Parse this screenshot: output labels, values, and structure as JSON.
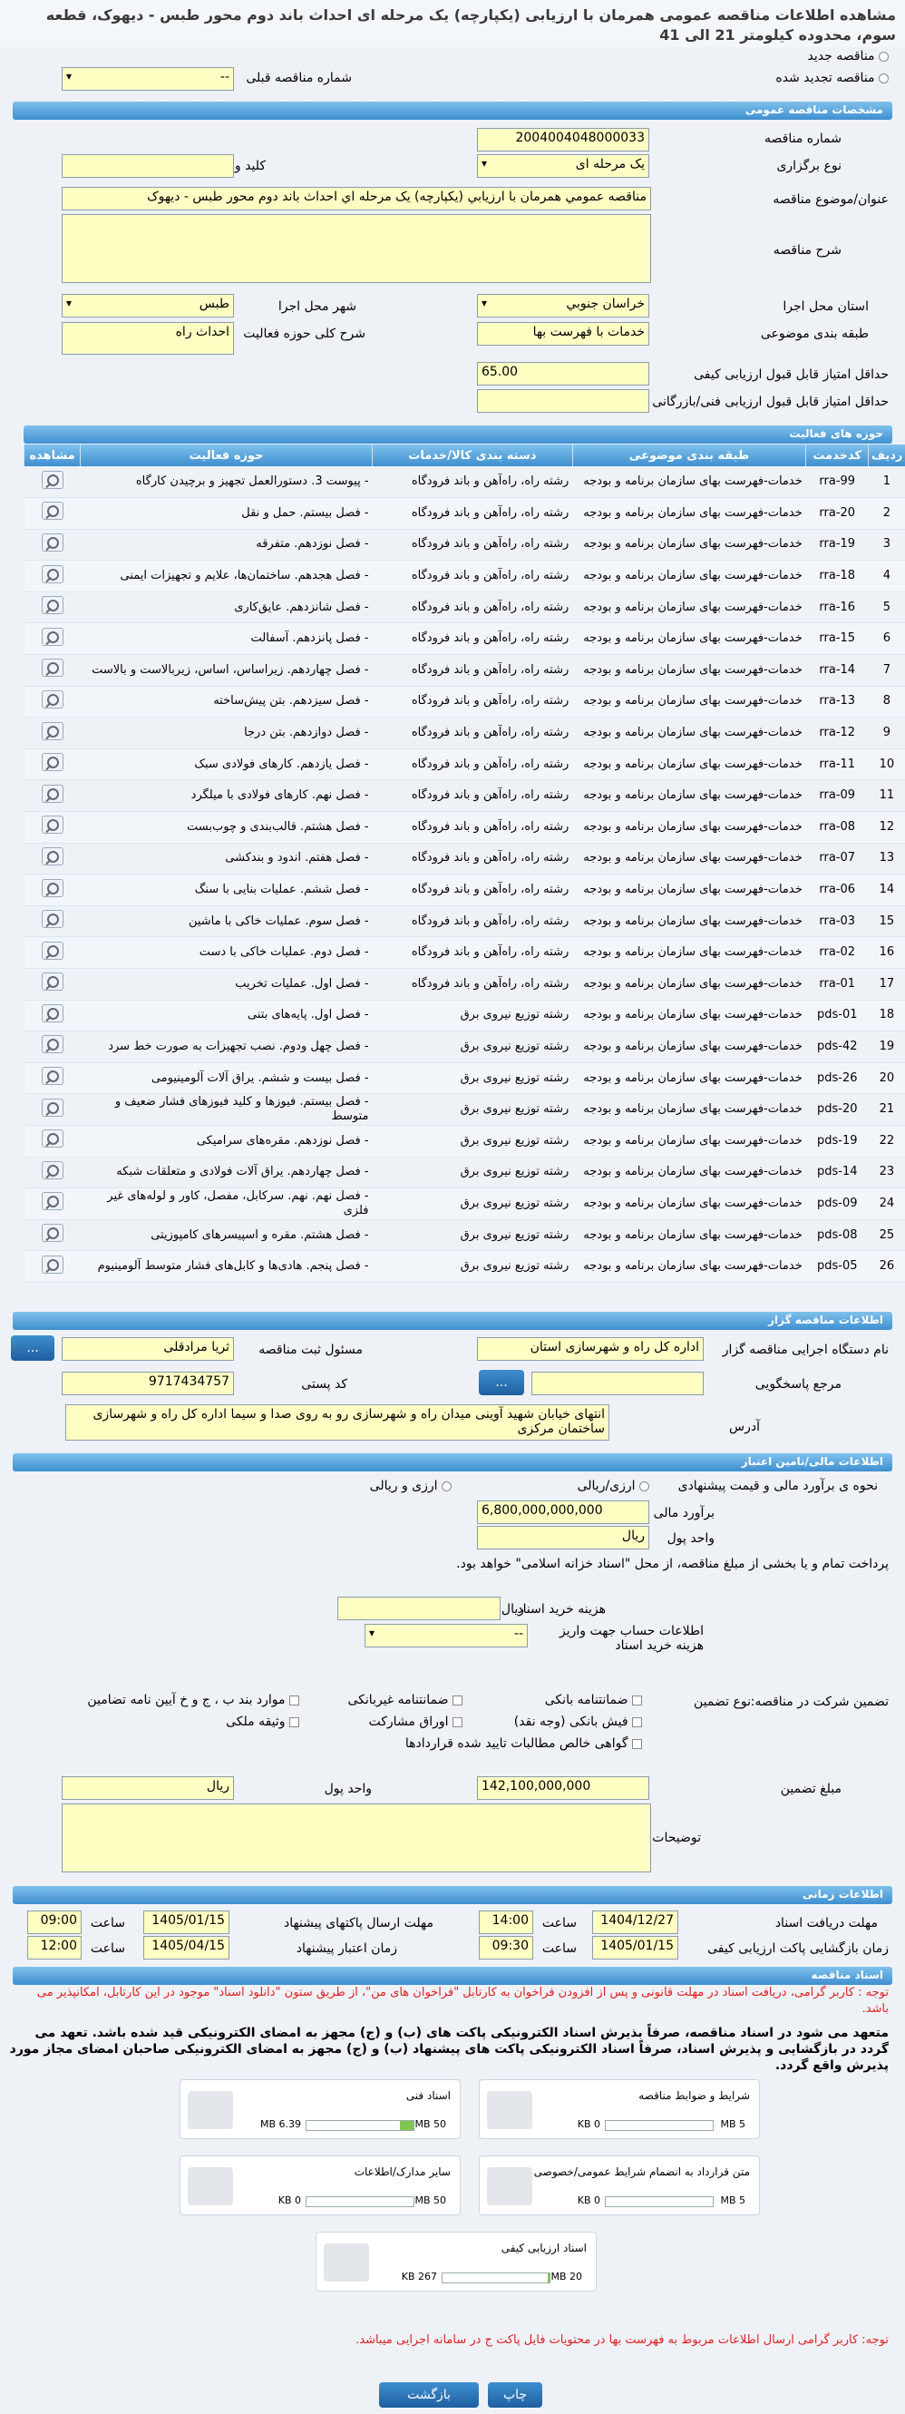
{
  "title": "مشاهده اطلاعات مناقصه عمومی همرمان با ارزیابی (یکپارچه) یک مرحله ای احداث باند دوم محور طبس - دیهوک، قطعه سوم، محدوده کیلومتر 21 الی 41",
  "status": {
    "new": "مناقصه جدید",
    "renewed": "مناقصه تجدید شده",
    "prev_label": "شماره مناقصه قبلی",
    "prev_value": "--"
  },
  "general": {
    "header": "مشخصات مناقصه عمومی",
    "number_label": "شماره مناقصه",
    "number": "2004004048000033",
    "type_label": "نوع برگزاری",
    "type": "یک مرحله ای",
    "keyword_label": "کلید واژه",
    "subject_label": "عنوان/موضوع مناقصه",
    "subject": "مناقصه عمومي همرمان با ارزيابي (يکپارچه) يک مرحله اي احداث باند دوم محور طبس - ديهوک",
    "desc_label": "شرح مناقصه",
    "province_label": "استان محل اجرا",
    "province": "خراسان جنوبي",
    "city_label": "شهر محل اجرا",
    "city": "طبس",
    "category_label": "طبقه بندی موضوعی",
    "category": "خدمات با فهرست بها",
    "scope_label": "شرح کلی حوزه فعالیت",
    "scope": "احداث راه",
    "quality_label": "حداقل امتیاز قابل قبول ارزیابی کیفی",
    "quality": "65.00",
    "tech_label": "حداقل امتیاز قابل قبول ارزیابی فنی/بازرگانی"
  },
  "activities": {
    "header": "حوزه های فعالیت",
    "cols": [
      "ردیف",
      "کدخدمت",
      "طبقه بندی موضوعی",
      "دسته بندی کالا/خدمات",
      "حوزه فعالیت",
      "مشاهده"
    ],
    "rows": [
      [
        "1",
        "rra-99",
        "خدمات-فهرست بهای سازمان برنامه و بودجه",
        "رشته راه، راه‌آهن و باند فرودگاه",
        "- پیوست 3. دستورالعمل تجهیز و برچیدن کارگاه"
      ],
      [
        "2",
        "rra-20",
        "خدمات-فهرست بهای سازمان برنامه و بودجه",
        "رشته راه، راه‌آهن و باند فرودگاه",
        "- فصل بیستم. حمل و نقل"
      ],
      [
        "3",
        "rra-19",
        "خدمات-فهرست بهای سازمان برنامه و بودجه",
        "رشته راه، راه‌آهن و باند فرودگاه",
        "- فصل نوزدهم. متفرقه"
      ],
      [
        "4",
        "rra-18",
        "خدمات-فهرست بهای سازمان برنامه و بودجه",
        "رشته راه، راه‌آهن و باند فرودگاه",
        "- فصل هجدهم. ساختمان‌ها، علایم و تجهیزات ایمنی"
      ],
      [
        "5",
        "rra-16",
        "خدمات-فهرست بهای سازمان برنامه و بودجه",
        "رشته راه، راه‌آهن و باند فرودگاه",
        "- فصل شانزدهم. عایق‌کاری"
      ],
      [
        "6",
        "rra-15",
        "خدمات-فهرست بهای سازمان برنامه و بودجه",
        "رشته راه، راه‌آهن و باند فرودگاه",
        "- فصل پانزدهم. آسفالت"
      ],
      [
        "7",
        "rra-14",
        "خدمات-فهرست بهای سازمان برنامه و بودجه",
        "رشته راه، راه‌آهن و باند فرودگاه",
        "- فصل چهاردهم. زیراساس، اساس، زیربالاست و بالاست"
      ],
      [
        "8",
        "rra-13",
        "خدمات-فهرست بهای سازمان برنامه و بودجه",
        "رشته راه، راه‌آهن و باند فرودگاه",
        "- فصل سیزدهم. بتن پیش‌ساخته"
      ],
      [
        "9",
        "rra-12",
        "خدمات-فهرست بهای سازمان برنامه و بودجه",
        "رشته راه، راه‌آهن و باند فرودگاه",
        "- فصل دوازدهم. بتن درجا"
      ],
      [
        "10",
        "rra-11",
        "خدمات-فهرست بهای سازمان برنامه و بودجه",
        "رشته راه، راه‌آهن و باند فرودگاه",
        "- فصل یازدهم. کارهای فولادی سبک"
      ],
      [
        "11",
        "rra-09",
        "خدمات-فهرست بهای سازمان برنامه و بودجه",
        "رشته راه، راه‌آهن و باند فرودگاه",
        "- فصل نهم. کارهای فولادی با میلگرد"
      ],
      [
        "12",
        "rra-08",
        "خدمات-فهرست بهای سازمان برنامه و بودجه",
        "رشته راه، راه‌آهن و باند فرودگاه",
        "- فصل هشتم. قالب‌بندی و چوب‌بست"
      ],
      [
        "13",
        "rra-07",
        "خدمات-فهرست بهای سازمان برنامه و بودجه",
        "رشته راه، راه‌آهن و باند فرودگاه",
        "- فصل هفتم. اندود و بندکشی"
      ],
      [
        "14",
        "rra-06",
        "خدمات-فهرست بهای سازمان برنامه و بودجه",
        "رشته راه، راه‌آهن و باند فرودگاه",
        "- فصل ششم. عملیات بنایی با سنگ"
      ],
      [
        "15",
        "rra-03",
        "خدمات-فهرست بهای سازمان برنامه و بودجه",
        "رشته راه، راه‌آهن و باند فرودگاه",
        "- فصل سوم. عملیات خاکی با ماشین"
      ],
      [
        "16",
        "rra-02",
        "خدمات-فهرست بهای سازمان برنامه و بودجه",
        "رشته راه، راه‌آهن و باند فرودگاه",
        "- فصل دوم. عملیات خاکی با دست"
      ],
      [
        "17",
        "rra-01",
        "خدمات-فهرست بهای سازمان برنامه و بودجه",
        "رشته راه، راه‌آهن و باند فرودگاه",
        "- فصل اول. عملیات تخریب"
      ],
      [
        "18",
        "pds-01",
        "خدمات-فهرست بهای سازمان برنامه و بودجه",
        "رشته توزیع نیروی برق",
        "- فصل اول. پایه‌های بتنی"
      ],
      [
        "19",
        "pds-42",
        "خدمات-فهرست بهای سازمان برنامه و بودجه",
        "رشته توزیع نیروی برق",
        "- فصل چهل ودوم. نصب تجهیزات به صورت خط سرد"
      ],
      [
        "20",
        "pds-26",
        "خدمات-فهرست بهای سازمان برنامه و بودجه",
        "رشته توزیع نیروی برق",
        "- فصل بیست و ششم. یراق آلات آلومینیومی"
      ],
      [
        "21",
        "pds-20",
        "خدمات-فهرست بهای سازمان برنامه و بودجه",
        "رشته توزیع نیروی برق",
        "- فصل بیستم. فیوزها و کلید فیوزهای فشار ضعیف و متوسط"
      ],
      [
        "22",
        "pds-19",
        "خدمات-فهرست بهای سازمان برنامه و بودجه",
        "رشته توزیع نیروی برق",
        "- فصل نوزدهم. مقره‌های سرامیکی"
      ],
      [
        "23",
        "pds-14",
        "خدمات-فهرست بهای سازمان برنامه و بودجه",
        "رشته توزیع نیروی برق",
        "- فصل چهاردهم. یراق آلات فولادی و متعلقات شبکه"
      ],
      [
        "24",
        "pds-09",
        "خدمات-فهرست بهای سازمان برنامه و بودجه",
        "رشته توزیع نیروی برق",
        "- فصل نهم. نهم. سرکابل، مفصل، کاور و لوله‌های غیر فلزی"
      ],
      [
        "25",
        "pds-08",
        "خدمات-فهرست بهای سازمان برنامه و بودجه",
        "رشته توزیع نیروی برق",
        "- فصل هشتم. مقره و اسپیسرهای کامپوزیتی"
      ],
      [
        "26",
        "pds-05",
        "خدمات-فهرست بهای سازمان برنامه و بودجه",
        "رشته توزیع نیروی برق",
        "- فصل پنجم. هادی‌ها و کابل‌های فشار متوسط آلومینیوم"
      ]
    ]
  },
  "organizer": {
    "header": "اطلاعات مناقصه گزار",
    "name_label": "نام دستگاه اجرایی مناقصه گزار",
    "name": "اداره کل راه و شهرسازی استان",
    "resp_label": "مسئول ثبت مناقصه",
    "resp": "ثریا  مرادقلی",
    "ref_label": "مرجع پاسخگویی",
    "postal_label": "کد پستی",
    "postal": "9717434757",
    "addr_label": "آدرس",
    "addr": "انتهای خیابان شهید آوینی میدان راه و شهرسازی رو به روی صدا و سیما اداره کل راه و شهرسازی ساختمان مرکزی",
    "more": "..."
  },
  "finance": {
    "header": "اطلاعات مالی/تامین اعتبار",
    "est_label": "نحوه ی برآورد مالی و قیمت پیشنهادی",
    "opt1": "ارزی/ریالی",
    "opt2": "ارزی و ریالی",
    "amount_label": "برآورد مالی",
    "amount": "6,800,000,000,000",
    "unit_label": "واحد پول",
    "unit": "ریال",
    "note": "پرداخت تمام و یا بخشی از مبلغ مناقصه، از محل \"اسناد خزانه اسلامی\" خواهد بود.",
    "doc_fee_label": "هزینه خرید اسناد",
    "doc_fee_unit": "ریال",
    "acct_label": "اطلاعات حساب جهت واریز هزینه خرید اسناد",
    "acct_value": "--",
    "guar_label": "تضمین شرکت در مناقصه:",
    "guar_type_label": "نوع تضمین",
    "g1": "ضمانتنامه بانکی",
    "g2": "ضمانتنامه غیربانکی",
    "g3": "موارد بند ب ، ج و خ آیین نامه تضامین",
    "g4": "فیش بانکی (وجه نقد)",
    "g5": "اوراق مشارکت",
    "g6": "وثیقه ملکی",
    "g7": "گواهی خالص مطالبات تایید شده قراردادها",
    "guar_amount_label": "مبلغ تضمین",
    "guar_amount": "142,100,000,000",
    "guar_unit_label": "واحد پول",
    "guar_unit": "ریال",
    "notes_label": "توضیحات"
  },
  "timing": {
    "header": "اطلاعات زمانی",
    "recv_label": "مهلت دریافت اسناد",
    "recv_date": "1404/12/27",
    "recv_time": "14:00",
    "send_label": "مهلت ارسال پاکتهای پیشنهاد",
    "send_date": "1405/01/15",
    "send_time": "09:00",
    "open_label": "زمان بازگشایی پاکت ارزیابی کیفی",
    "open_date": "1405/01/15",
    "open_time": "09:30",
    "valid_label": "زمان اعتبار پیشنهاد",
    "valid_date": "1405/04/15",
    "valid_time": "12:00",
    "time_word": "ساعت"
  },
  "docs": {
    "header": "اسناد مناقصه",
    "warn1": "توجه : کاربر گرامی، دریافت اسناد در مهلت قانونی و پس از افزودن فراخوان به کارتابل \"فراخوان های من\"، از طریق ستون \"دانلود اسناد\" موجود در این کارتابل، امکانپذیر می باشد.",
    "warn2": "متعهد می شود در اسناد مناقصه، صرفاً بذیرش اسناد الکترونیکی پاکت های (ب) و (ج) مجهز به امضای الکترونیکی قید شده باشد. تعهد می گردد در بازگشایی و پذیرش اسناد، صرفاً اسناد الکترونیکی پاکت های پیشنهاد (ب) و (ج) مجهز به امضای الکترونیکی صاحبان امضای مجاز مورد پذیرش واقع گردد.",
    "items": [
      {
        "name": "شرایط و ضوابط مناقصه",
        "size": "0 KB",
        "max": "5 MB",
        "pct": 0
      },
      {
        "name": "اسناد فنی",
        "size": "6.39 MB",
        "max": "50 MB",
        "pct": 0.13
      },
      {
        "name": "متن قرارداد به انضمام شرایط عمومی/خصوصی",
        "size": "0 KB",
        "max": "5 MB",
        "pct": 0
      },
      {
        "name": "سایر مدارک/اطلاعات",
        "size": "0 KB",
        "max": "50 MB",
        "pct": 0
      },
      {
        "name": "اسناد ارزیابی کیفی",
        "size": "267 KB",
        "max": "20 MB",
        "pct": 0.013
      }
    ],
    "warn3": "توجه: کاربر گرامی ارسال اطلاعات مربوط به فهرست بها در محتویات فایل پاکت ج در سامانه اجرایی میباشد."
  },
  "footer": {
    "print": "چاپ",
    "back": "بازگشت"
  }
}
